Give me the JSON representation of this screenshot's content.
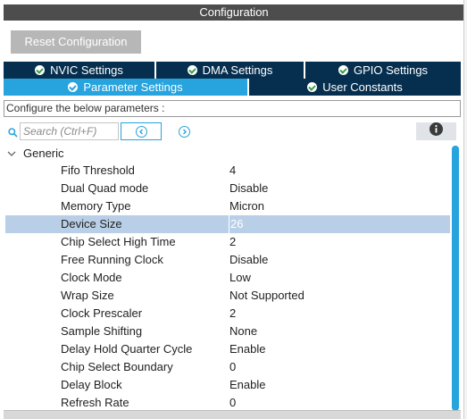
{
  "window": {
    "title": "Configuration"
  },
  "toolbar": {
    "reset_label": "Reset Configuration"
  },
  "tabs": [
    {
      "label": "NVIC Settings",
      "active": false
    },
    {
      "label": "DMA Settings",
      "active": false
    },
    {
      "label": "GPIO Settings",
      "active": false
    },
    {
      "label": "Parameter Settings",
      "active": true
    },
    {
      "label": "User Constants",
      "active": false
    }
  ],
  "description": "Configure the below parameters :",
  "search": {
    "placeholder": "Search (Ctrl+F)"
  },
  "group": {
    "label": "Generic",
    "expanded": true
  },
  "parameters": [
    {
      "name": "Fifo Threshold",
      "value": "4"
    },
    {
      "name": "Dual Quad mode",
      "value": "Disable"
    },
    {
      "name": "Memory Type",
      "value": "Micron"
    },
    {
      "name": "Device Size",
      "value": "26",
      "selected": true
    },
    {
      "name": "Chip Select High Time",
      "value": "2"
    },
    {
      "name": "Free Running Clock",
      "value": "Disable"
    },
    {
      "name": "Clock Mode",
      "value": "Low"
    },
    {
      "name": "Wrap Size",
      "value": "Not Supported"
    },
    {
      "name": "Clock Prescaler",
      "value": "2"
    },
    {
      "name": "Sample Shifting",
      "value": "None"
    },
    {
      "name": "Delay Hold Quarter Cycle",
      "value": "Enable"
    },
    {
      "name": "Chip Select Boundary",
      "value": "0"
    },
    {
      "name": "Delay Block",
      "value": "Enable"
    },
    {
      "name": "Refresh Rate",
      "value": "0"
    }
  ],
  "colors": {
    "accent": "#27a3dd",
    "tab_dark": "#062f4f",
    "selected_row": "#b9cfe7",
    "title_bar": "#4d4d4d"
  },
  "icons": {
    "tab_check": "check-circle-icon",
    "search": "search-icon",
    "prev": "chevron-left-circle-icon",
    "next": "chevron-right-circle-icon",
    "info": "info-icon",
    "group_toggle": "chevron-down-icon"
  }
}
